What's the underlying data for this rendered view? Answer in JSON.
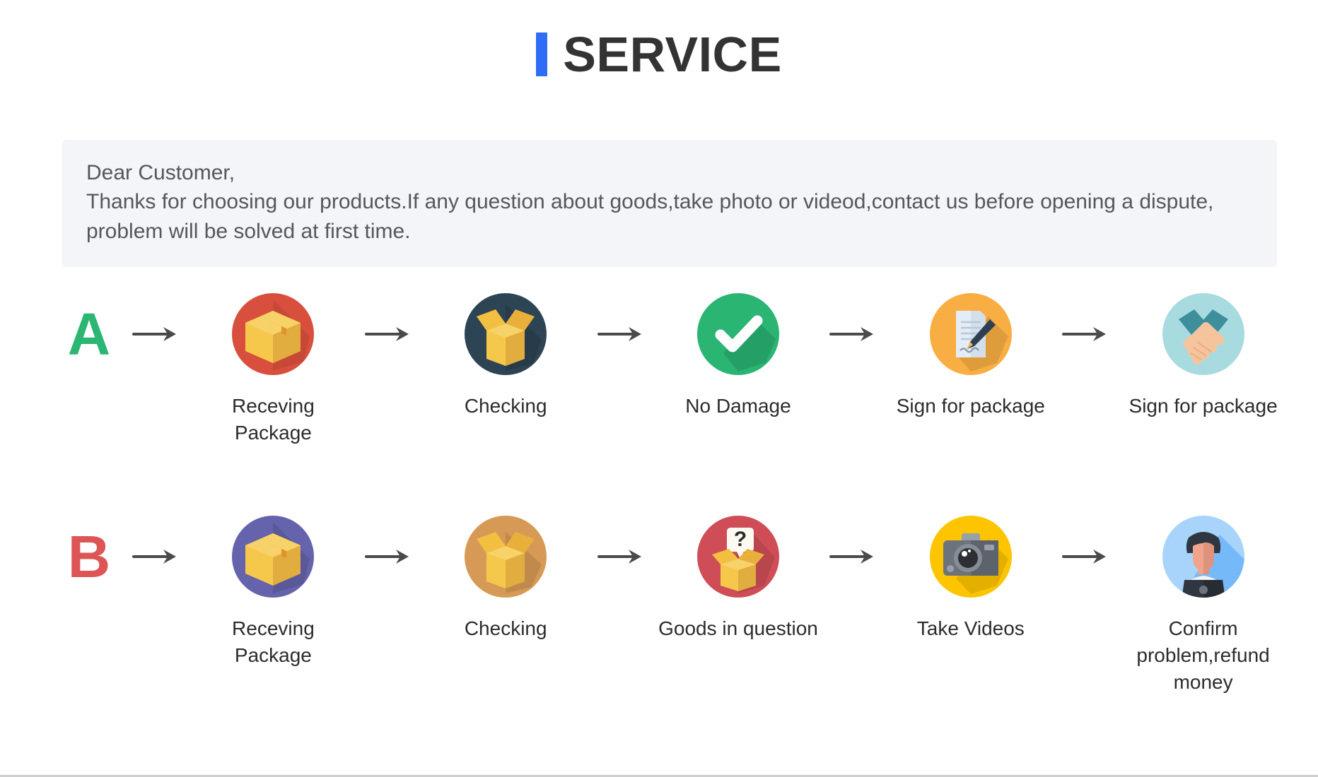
{
  "header": {
    "title": "SERVICE",
    "accent_color": "#2f6df6",
    "title_color": "#333333"
  },
  "note": {
    "background": "#f4f5f9",
    "lines": [
      "Dear Customer,",
      "Thanks for choosing our products.If any question about goods,take photo or videod,contact us before opening a dispute,",
      "problem will be solved at first time."
    ]
  },
  "flows": [
    {
      "letter": "A",
      "letter_color": "#2bb673",
      "steps": [
        {
          "label": "Receving Package",
          "icon": "package-box-icon",
          "circle_color": "#d94f3d"
        },
        {
          "label": "Checking",
          "icon": "open-box-icon",
          "circle_color": "#2d4455"
        },
        {
          "label": "No Damage",
          "icon": "check-mark-icon",
          "circle_color": "#2ab573"
        },
        {
          "label": "Sign for package",
          "icon": "document-pen-icon",
          "circle_color": "#f9ae43"
        },
        {
          "label": "Sign for package",
          "icon": "handshake-icon",
          "circle_color": "#a8dbe0"
        }
      ]
    },
    {
      "letter": "B",
      "letter_color": "#dd5555",
      "steps": [
        {
          "label": "Receving Package",
          "icon": "package-box-icon",
          "circle_color": "#6563ab"
        },
        {
          "label": "Checking",
          "icon": "open-box-icon",
          "circle_color": "#d79a56"
        },
        {
          "label": "Goods in question",
          "icon": "question-box-icon",
          "circle_color": "#cf4d56"
        },
        {
          "label": "Take Videos",
          "icon": "camera-icon",
          "circle_color": "#fdc500"
        },
        {
          "label": "Confirm  problem,refund money",
          "icon": "support-person-icon",
          "circle_color": "#a8d4fb"
        }
      ]
    }
  ],
  "arrow": {
    "name": "arrow-right-icon",
    "color": "#4a4a4a"
  }
}
